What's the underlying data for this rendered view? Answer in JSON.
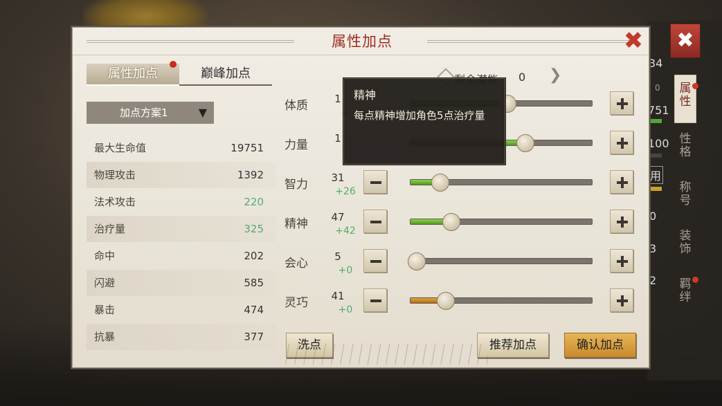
{
  "panel": {
    "title": "属性加点",
    "close_glyph": "✖"
  },
  "tabs": [
    {
      "label": "属性加点"
    },
    {
      "label": "巅峰加点"
    }
  ],
  "plan_select": {
    "label": "加点方案1",
    "arrow_glyph": "▼"
  },
  "stats": [
    {
      "label": "最大生命值",
      "value": "19751"
    },
    {
      "label": "物理攻击",
      "value": "1392"
    },
    {
      "label": "法术攻击",
      "value": "220"
    },
    {
      "label": "治疗量",
      "value": "325"
    },
    {
      "label": "命中",
      "value": "202"
    },
    {
      "label": "闪避",
      "value": "585"
    },
    {
      "label": "暴击",
      "value": "474"
    },
    {
      "label": "抗暴",
      "value": "377"
    }
  ],
  "remaining": {
    "label": "剩余潜能",
    "value": "0"
  },
  "attributes": [
    {
      "name": "体质",
      "value": "1",
      "bonus": "+",
      "fill": 0.5,
      "fill_color": "green"
    },
    {
      "name": "力量",
      "value": "1",
      "bonus": "+",
      "fill": 0.6,
      "fill_color": "green"
    },
    {
      "name": "智力",
      "value": "31",
      "bonus": "+26",
      "fill": 0.13,
      "fill_color": "green"
    },
    {
      "name": "精神",
      "value": "47",
      "bonus": "+42",
      "fill": 0.19,
      "fill_color": "green"
    },
    {
      "name": "会心",
      "value": "5",
      "bonus": "+0",
      "fill": 0.0,
      "fill_color": "green"
    },
    {
      "name": "灵巧",
      "value": "41",
      "bonus": "+0",
      "fill": 0.16,
      "fill_color": "orange"
    }
  ],
  "tooltip": {
    "title": "精神",
    "body": "每点精神增加角色5点治疗量"
  },
  "buttons": {
    "reset": "洗点",
    "recommend": "推荐加点",
    "confirm": "确认加点"
  },
  "side_panel": {
    "close_glyph": "✖",
    "tabs": [
      "属性",
      "性格",
      "称号",
      "装饰",
      "羁绊"
    ],
    "numbers": [
      "34",
      "0",
      "751",
      "100",
      "用",
      "0",
      "3",
      "2"
    ]
  },
  "colors": {
    "title_red": "#9e2a20",
    "bonus_green": "#4fae69",
    "confirm_gold": "#d9a040"
  }
}
